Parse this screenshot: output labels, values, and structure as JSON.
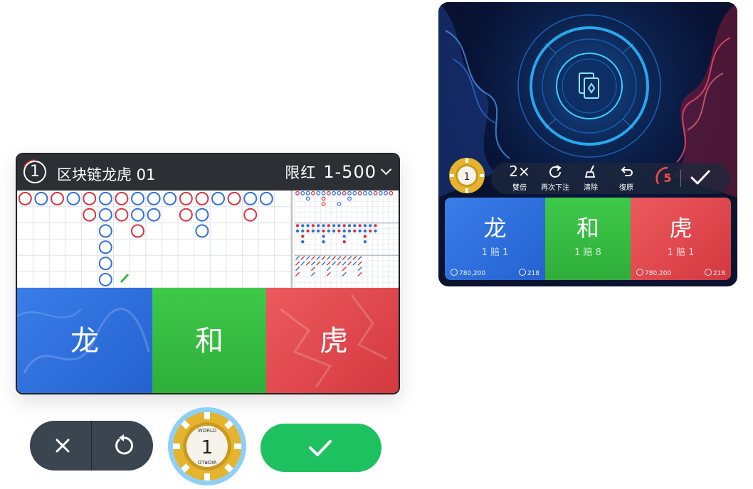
{
  "table": {
    "number": "1",
    "name": "区块链龙虎 01",
    "limit_label": "限红",
    "limit_value": "1-500"
  },
  "bets": {
    "dragon": {
      "label": "龙",
      "odds": "1 赔 1",
      "amount": "780,200",
      "players": "218"
    },
    "tie": {
      "label": "和",
      "odds": "1 赔 8"
    },
    "tiger": {
      "label": "虎",
      "odds": "1 赔 1",
      "amount": "780,200",
      "players": "218"
    }
  },
  "chip": {
    "value": "1",
    "text_top": "WORLD",
    "text_bottom": "WORLD"
  },
  "toolbar": {
    "double_icon": "2×",
    "double_label": "雙倍",
    "rebet_label": "再次下注",
    "clear_label": "清除",
    "undo_label": "復原",
    "count": "5"
  },
  "colors": {
    "dragon": "#2f6fe0",
    "tie": "#36bb43",
    "tiger": "#e04a50",
    "confirm": "#1ec15f",
    "cancel_pill": "#3a4550",
    "header": "#2c2f33"
  },
  "icons": [
    "close-icon",
    "undo-icon",
    "check-icon",
    "redo-icon",
    "broom-icon",
    "cards-icon",
    "coin-icon",
    "user-icon"
  ]
}
